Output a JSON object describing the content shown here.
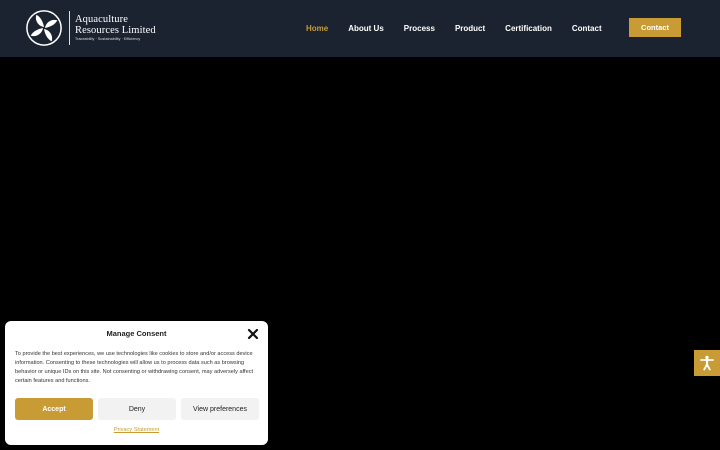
{
  "brand": {
    "line1": "Aquaculture",
    "line2": "Resources Limited",
    "tagline": "Traceability · Sustainability · Efficiency",
    "logo_icon": "four-fish-circle-logo"
  },
  "nav": {
    "items": [
      {
        "label": "Home",
        "active": true
      },
      {
        "label": "About Us",
        "active": false
      },
      {
        "label": "Process",
        "active": false
      },
      {
        "label": "Product",
        "active": false
      },
      {
        "label": "Certification",
        "active": false
      },
      {
        "label": "Contact",
        "active": false
      }
    ],
    "cta_label": "Contact"
  },
  "colors": {
    "header_bg": "#1b2230",
    "accent": "#c89b34",
    "page_bg": "#000000"
  },
  "accessibility": {
    "icon": "accessibility-person-icon"
  },
  "consent": {
    "title": "Manage Consent",
    "body": "To provide the best experiences, we use technologies like cookies to store and/or access device information. Consenting to these technologies will allow us to process data such as browsing behavior or unique IDs on this site. Not consenting or withdrawing consent, may adversely affect certain features and functions.",
    "accept_label": "Accept",
    "deny_label": "Deny",
    "preferences_label": "View preferences",
    "privacy_link": "Privacy Statement",
    "close_icon": "close-icon"
  }
}
